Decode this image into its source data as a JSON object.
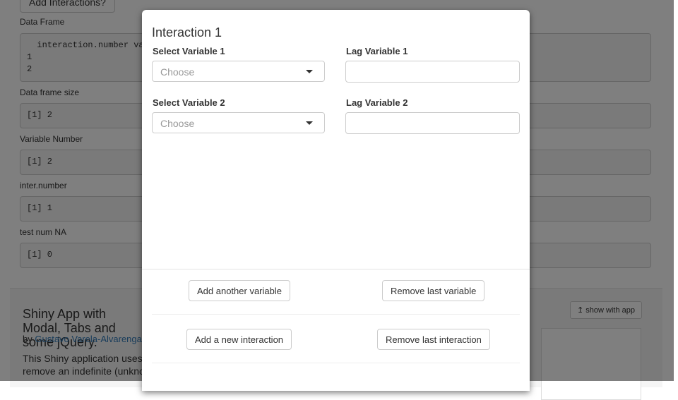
{
  "background_page": {
    "top_button_label": "Add Interactions?",
    "outputs": [
      {
        "label": "Data Frame",
        "lines": [
          "  interaction.number variable",
          "1",
          "2"
        ]
      },
      {
        "label": "Data frame size",
        "lines": [
          "[1] 2"
        ]
      },
      {
        "label": "Variable Number",
        "lines": [
          "[1] 2"
        ]
      },
      {
        "label": "inter.number",
        "lines": [
          "[1] 1"
        ]
      },
      {
        "label": "test num NA",
        "lines": [
          "[1] 0"
        ]
      }
    ],
    "showcase": {
      "title": "Shiny App with Modal, Tabs and some jQuery.",
      "by_prefix": "by",
      "author": "Gustavo Varela-Alvarenga",
      "description_line1": "This Shiny application uses modal",
      "description_line2": "remove an indefinite (unknown) number",
      "show_with_app_label": "show with app",
      "show_with_app_icon": "arrow-up-icon"
    }
  },
  "modal": {
    "title": "Interaction 1",
    "select_variable_1": {
      "label": "Select Variable 1",
      "placeholder": "Choose"
    },
    "lag_variable_1": {
      "label": "Lag Variable 1",
      "value": ""
    },
    "select_variable_2": {
      "label": "Select Variable 2",
      "placeholder": "Choose"
    },
    "lag_variable_2": {
      "label": "Lag Variable 2",
      "value": ""
    },
    "buttons": {
      "add_variable": "Add another variable",
      "remove_variable": "Remove last variable",
      "add_interaction": "Add a new interaction",
      "remove_interaction": "Remove last interaction"
    }
  }
}
